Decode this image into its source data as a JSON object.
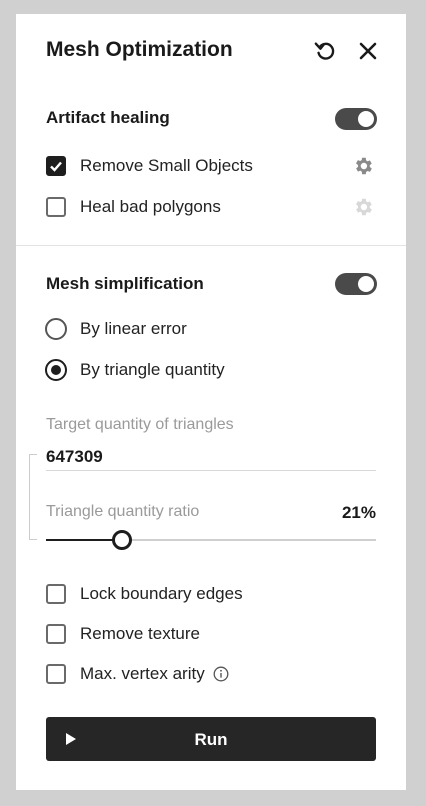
{
  "panel": {
    "title": "Mesh Optimization",
    "icons": {
      "reset": "reset-icon",
      "close": "close-icon"
    }
  },
  "artifact_healing": {
    "title": "Artifact healing",
    "enabled": true,
    "options": [
      {
        "label": "Remove Small Objects",
        "checked": true,
        "settings_icon": "gear-icon"
      },
      {
        "label": "Heal bad polygons",
        "checked": false,
        "settings_icon": "gear-icon"
      }
    ]
  },
  "mesh_simplification": {
    "title": "Mesh simplification",
    "enabled": true,
    "modes": [
      {
        "label": "By linear error",
        "selected": false
      },
      {
        "label": "By triangle quantity",
        "selected": true
      }
    ],
    "target_label": "Target quantity of triangles",
    "target_value": "647309",
    "ratio_label": "Triangle quantity ratio",
    "ratio_value": "21%",
    "ratio_fraction": 0.23
  },
  "options": [
    {
      "label": "Lock boundary edges",
      "checked": false
    },
    {
      "label": "Remove texture",
      "checked": false
    },
    {
      "label": "Max. vertex arity",
      "checked": false,
      "info_icon": "info-icon"
    }
  ],
  "run": {
    "label": "Run",
    "icon": "play-icon"
  },
  "colors": {
    "accent": "#1e1e1e",
    "toggle_on": "#4a4a4a",
    "muted": "#9a9a9a"
  }
}
